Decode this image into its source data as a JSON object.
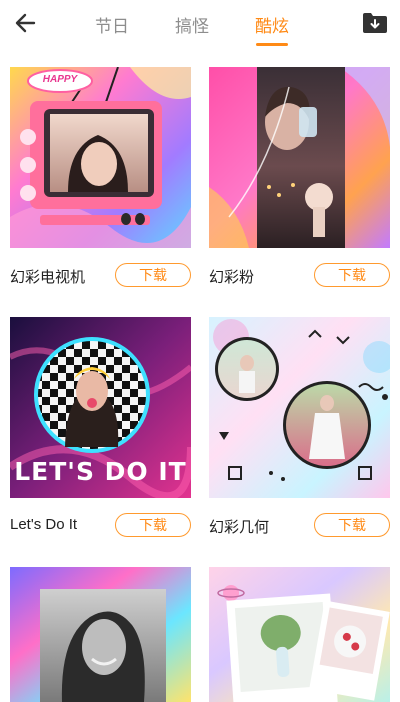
{
  "header": {
    "tabs": [
      {
        "label": "节日",
        "active": false
      },
      {
        "label": "搞怪",
        "active": false
      },
      {
        "label": "酷炫",
        "active": true
      }
    ]
  },
  "templates": [
    {
      "name": "幻彩电视机",
      "download_label": "下载",
      "badge_text": "HAPPY"
    },
    {
      "name": "幻彩粉",
      "download_label": "下载"
    },
    {
      "name": "Let's Do It",
      "download_label": "下载",
      "overlay_text": "LET'S DO IT"
    },
    {
      "name": "幻彩几何",
      "download_label": "下载"
    },
    {
      "name": "",
      "download_label": ""
    },
    {
      "name": "",
      "download_label": ""
    }
  ],
  "colors": {
    "accent": "#ff8a16",
    "inactive_tab": "#8d8d8d"
  }
}
